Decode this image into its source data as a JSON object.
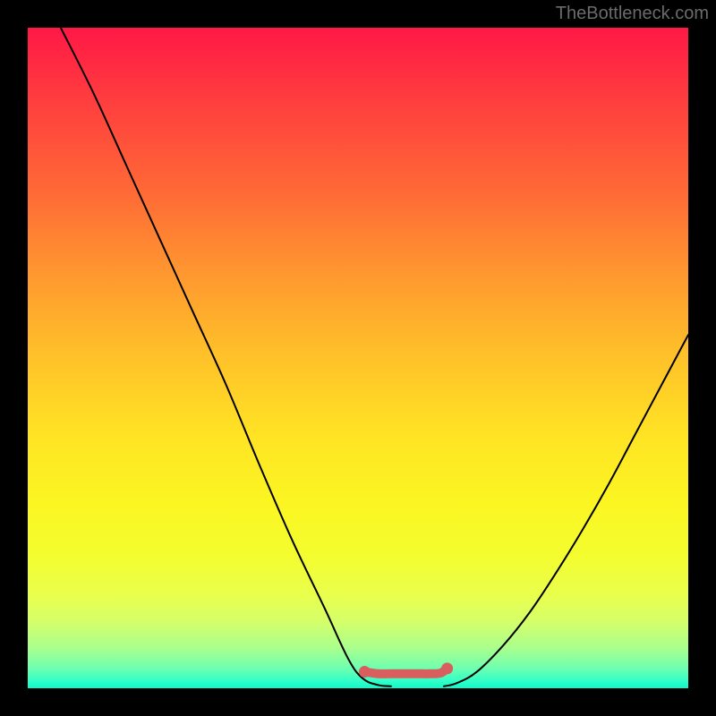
{
  "watermark": "TheBottleneck.com",
  "chart_data": {
    "type": "line",
    "title": "",
    "xlabel": "",
    "ylabel": "",
    "xlim": [
      0,
      100
    ],
    "ylim": [
      0,
      100
    ],
    "grid": false,
    "legend": false,
    "series": [
      {
        "name": "left-curve",
        "x": [
          5,
          10,
          15,
          20,
          25,
          30,
          35,
          40,
          45,
          48.5,
          50.7,
          53,
          55
        ],
        "values": [
          100,
          90,
          79,
          68,
          57,
          46,
          34,
          22.5,
          12,
          4.5,
          1.5,
          0.5,
          0.3
        ]
      },
      {
        "name": "right-curve",
        "x": [
          63,
          65,
          68,
          72,
          76,
          80,
          84,
          88,
          92,
          96,
          100
        ],
        "values": [
          0.3,
          0.8,
          2.5,
          6.5,
          11.5,
          17.5,
          24,
          31,
          38.5,
          46,
          53.5
        ]
      },
      {
        "name": "bottom-flat",
        "x": [
          51,
          53,
          55,
          57,
          59,
          61,
          62.5,
          63.5
        ],
        "values": [
          2.5,
          2.2,
          2.2,
          2.2,
          2.2,
          2.2,
          2.3,
          3.0
        ],
        "style": "thick-red"
      }
    ],
    "colors": {
      "curve": "#000000",
      "flat": "#d95f5f"
    }
  }
}
